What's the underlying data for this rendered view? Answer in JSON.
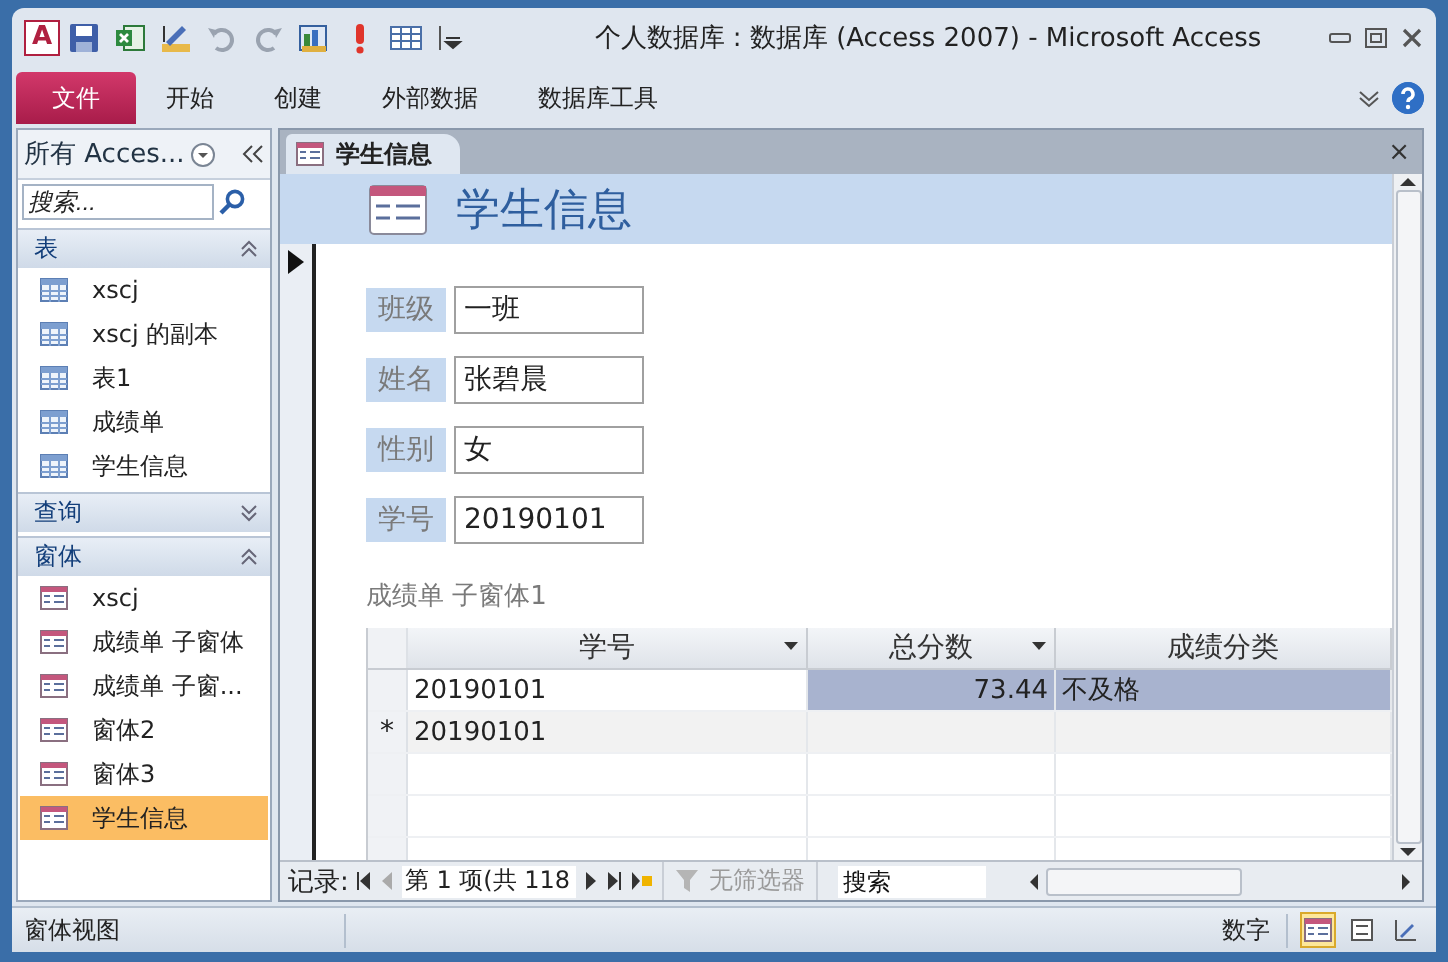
{
  "window": {
    "logo": "A",
    "title": "个人数据库 : 数据库 (Access 2007)  -  Microsoft Access"
  },
  "ribbon_tabs": [
    {
      "label": "文件",
      "selected": true
    },
    {
      "label": "开始",
      "selected": false
    },
    {
      "label": "创建",
      "selected": false
    },
    {
      "label": "外部数据",
      "selected": false
    },
    {
      "label": "数据库工具",
      "selected": false
    }
  ],
  "nav_pane": {
    "title": "所有 Acces...",
    "search": {
      "placeholder": "搜索..."
    },
    "groups": [
      {
        "label": "表",
        "expanded": true,
        "kind": "table",
        "items": [
          {
            "label": "xscj",
            "selected": false
          },
          {
            "label": "xscj 的副本",
            "selected": false
          },
          {
            "label": "表1",
            "selected": false
          },
          {
            "label": "成绩单",
            "selected": false
          },
          {
            "label": "学生信息",
            "selected": false
          }
        ]
      },
      {
        "label": "查询",
        "expanded": false
      },
      {
        "label": "窗体",
        "expanded": true,
        "kind": "form",
        "items": [
          {
            "label": "xscj",
            "selected": false
          },
          {
            "label": "成绩单 子窗体",
            "selected": false
          },
          {
            "label": "成绩单 子窗...",
            "selected": false
          },
          {
            "label": "窗体2",
            "selected": false
          },
          {
            "label": "窗体3",
            "selected": false
          },
          {
            "label": "学生信息",
            "selected": true
          }
        ]
      }
    ]
  },
  "document_tab": {
    "label": "学生信息",
    "close": "×"
  },
  "form": {
    "title": "学生信息",
    "fields": [
      {
        "label": "班级",
        "value": "一班"
      },
      {
        "label": "姓名",
        "value": "张碧晨"
      },
      {
        "label": "性别",
        "value": "女"
      },
      {
        "label": "学号",
        "value": "20190101"
      }
    ],
    "subform": {
      "label": "成绩单 子窗体1",
      "columns": [
        {
          "label": "学号",
          "has_menu": true,
          "kind": "text"
        },
        {
          "label": "总分数",
          "has_menu": true,
          "kind": "number"
        },
        {
          "label": "成绩分类",
          "has_menu": false,
          "kind": "text"
        }
      ],
      "rows": [
        {
          "kind": "current",
          "cells": [
            "20190101",
            "73.44",
            "不及格"
          ]
        },
        {
          "kind": "new",
          "marker": "*",
          "cells": [
            "20190101"
          ]
        }
      ]
    }
  },
  "record_nav": {
    "label": "记录:",
    "position": "第 1 项(共 118",
    "filter": {
      "label": "无筛选器",
      "disabled": true
    },
    "search": {
      "placeholder": "搜索"
    }
  },
  "status_bar": {
    "left": "窗体视图",
    "indicator": "数字",
    "views": [
      {
        "kind": "form",
        "selected": true
      },
      {
        "kind": "layout",
        "selected": false
      },
      {
        "kind": "design",
        "selected": false
      }
    ]
  }
}
